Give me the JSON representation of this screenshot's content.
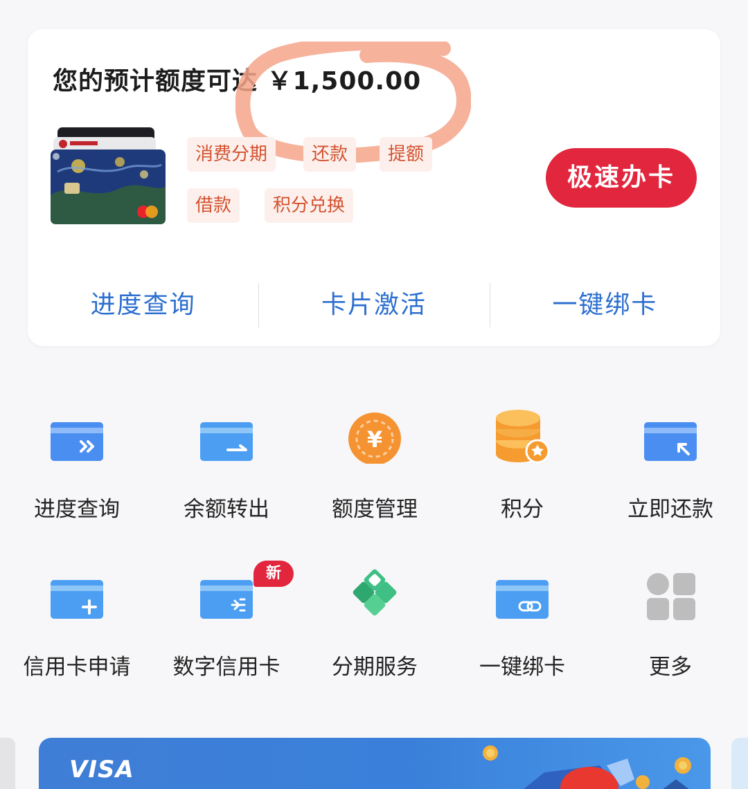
{
  "card": {
    "headline_prefix": "您的预计额度可达",
    "headline_amount": "￥1,500.00",
    "tags": [
      "消费分期",
      "还款",
      "提额",
      "借款",
      "积分兑换"
    ],
    "apply_button": "极速办卡",
    "links": [
      "进度查询",
      "卡片激活",
      "一键绑卡"
    ]
  },
  "services": [
    {
      "label": "进度查询",
      "icon": "card-forward-icon"
    },
    {
      "label": "余额转出",
      "icon": "card-transfer-icon"
    },
    {
      "label": "额度管理",
      "icon": "yuan-coin-icon"
    },
    {
      "label": "积分",
      "icon": "coin-stack-star-icon"
    },
    {
      "label": "立即还款",
      "icon": "card-arrow-icon"
    },
    {
      "label": "信用卡申请",
      "icon": "card-plus-icon"
    },
    {
      "label": "数字信用卡",
      "icon": "card-digital-icon"
    },
    {
      "label": "分期服务",
      "icon": "diamond-grid-icon"
    },
    {
      "label": "一键绑卡",
      "icon": "card-link-icon"
    },
    {
      "label": "更多",
      "icon": "more-grid-icon"
    }
  ],
  "new_badge": "新",
  "banner": {
    "brand": "VISA"
  },
  "colors": {
    "accent_red": "#e1263d",
    "link_blue": "#2d6fcf",
    "tag_text": "#d3522f",
    "tag_bg": "#fdf0ec",
    "annotation_circle": "#f4a58a"
  }
}
